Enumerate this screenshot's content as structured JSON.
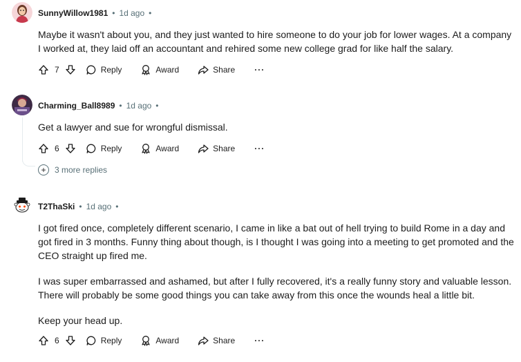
{
  "comments": [
    {
      "author": "SunnyWillow1981",
      "time": "1d ago",
      "paragraphs": [
        "Maybe it wasn't about you, and they just wanted to hire someone to do your job for lower wages. At a company I worked at, they laid off an accountant and rehired some new college grad for like half the salary."
      ],
      "votes": "7"
    },
    {
      "author": "Charming_Ball8989",
      "time": "1d ago",
      "paragraphs": [
        "Get a lawyer and sue for wrongful dismissal."
      ],
      "votes": "6",
      "more_replies": "3 more replies"
    },
    {
      "author": "T2ThaSki",
      "time": "1d ago",
      "paragraphs": [
        "I got fired once, completely different scenario, I came in like a bat out of hell trying to build Rome in a day and got fired in 3 months. Funny thing about though, is I thought I was going into a meeting to get promoted and the CEO straight up fired me.",
        "I was super embarrassed and ashamed, but after I fully recovered, it's a really funny story and valuable lesson. There will probably be some good things you can take away from this once the wounds heal a little bit.",
        "Keep your head up."
      ],
      "votes": "6"
    }
  ],
  "actions": {
    "reply": "Reply",
    "award": "Award",
    "share": "Share",
    "more": "···"
  },
  "separator": "•",
  "icons": [
    "upvote-icon",
    "downvote-icon",
    "reply-icon",
    "award-icon",
    "share-icon",
    "plus-circle-icon"
  ]
}
